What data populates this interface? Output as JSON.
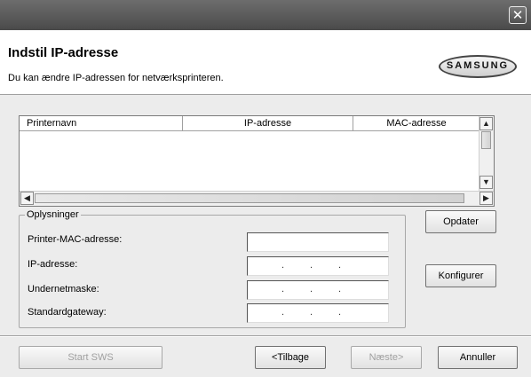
{
  "title": "Indstil IP-adresse",
  "subtitle": "Du kan ændre IP-adressen for netværksprinteren.",
  "logo_text": "SAMSUNG",
  "close_icon": "close-icon",
  "list": {
    "columns": [
      "Printernavn",
      "IP-adresse",
      "MAC-adresse"
    ],
    "rows": []
  },
  "info": {
    "legend": "Oplysninger",
    "fields": [
      {
        "label": "Printer-MAC-adresse:",
        "value": ""
      },
      {
        "label": "IP-adresse:",
        "value": ". . ."
      },
      {
        "label": "Undernetmaske:",
        "value": ". . ."
      },
      {
        "label": "Standardgateway:",
        "value": ". . ."
      }
    ]
  },
  "buttons": {
    "update": "Opdater",
    "configure": "Konfigurer",
    "start_sws": "Start SWS",
    "back": "<Tilbage",
    "next": "Næste>",
    "cancel": "Annuller"
  },
  "scroll": {
    "up": "▲",
    "down": "▼",
    "left": "◀",
    "right": "▶"
  }
}
